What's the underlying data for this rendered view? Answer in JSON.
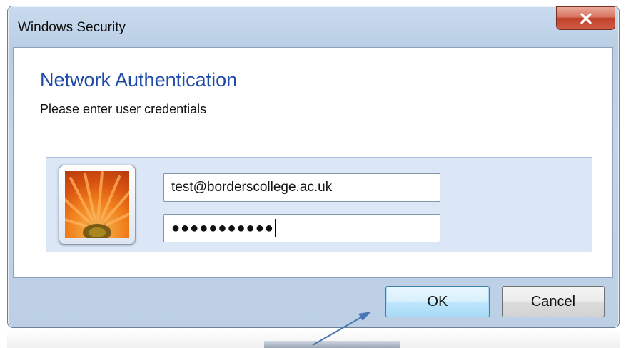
{
  "window": {
    "title": "Windows Security",
    "close_icon": "close-icon"
  },
  "dialog": {
    "heading": "Network Authentication",
    "subheading": "Please enter user credentials"
  },
  "credentials": {
    "user_tile_icon": "user-picture-flower",
    "username_value": "test@borderscollege.ac.uk",
    "password_masked": "●●●●●●●●●●●"
  },
  "buttons": {
    "ok_label": "OK",
    "cancel_label": "Cancel"
  },
  "annotation": {
    "arrow_icon": "pointer-arrow",
    "arrow_color": "#4a77b4"
  },
  "colors": {
    "heading": "#1e4aa8",
    "close_button": "#c0402a",
    "credential_panel": "#dbe7f6"
  }
}
